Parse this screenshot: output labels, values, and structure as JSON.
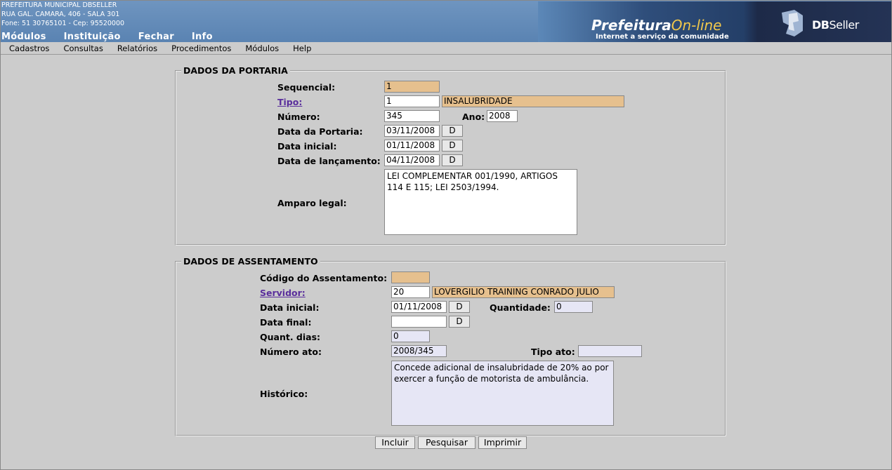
{
  "org": {
    "name": "PREFEITURA MUNICIPAL DBSELLER",
    "address": "RUA GAL. CAMARA, 406 - SALA 301",
    "contact": "Fone: 51 30765101  -  Cep: 95520000"
  },
  "top_menu": [
    "Módulos",
    "Instituição",
    "Fechar",
    "Info"
  ],
  "banner": {
    "prefeitura": "Prefeitura",
    "online": "On-line",
    "tagline": "Internet a serviço da comunidade",
    "db": "DB",
    "seller": "Seller"
  },
  "sub_menu": [
    "Cadastros",
    "Consultas",
    "Relatórios",
    "Procedimentos",
    "Módulos",
    "Help"
  ],
  "portaria": {
    "legend": "DADOS DA PORTARIA",
    "sequencial_label": "Sequencial:",
    "sequencial": "1",
    "tipo_label": "Tipo:",
    "tipo_code": "1",
    "tipo_desc": "INSALUBRIDADE",
    "numero_label": "Número:",
    "numero": "345",
    "ano_label": "Ano:",
    "ano": "2008",
    "data_portaria_label": "Data da Portaria:",
    "data_portaria": "03/11/2008",
    "data_inicial_label": "Data inicial:",
    "data_inicial": "01/11/2008",
    "data_lancamento_label": "Data de lançamento:",
    "data_lancamento": "04/11/2008",
    "date_button": "D",
    "amparo_label": "Amparo legal:",
    "amparo": "LEI COMPLEMENTAR 001/1990, ARTIGOS 114 E 115; LEI 2503/1994."
  },
  "assentamento": {
    "legend": "DADOS DE ASSENTAMENTO",
    "codigo_label": "Código do Assentamento:",
    "codigo": "",
    "servidor_label": "Servidor:",
    "servidor_code": "20",
    "servidor_name": "LOVERGILIO TRAINING CONRADO JULIO",
    "data_inicial_label": "Data inicial:",
    "data_inicial": "01/11/2008",
    "quantidade_label": "Quantidade:",
    "quantidade": "0",
    "data_final_label": "Data final:",
    "data_final": "",
    "quant_dias_label": "Quant. dias:",
    "quant_dias": "0",
    "numero_ato_label": "Número ato:",
    "numero_ato": "2008/345",
    "tipo_ato_label": "Tipo ato:",
    "tipo_ato": "",
    "historico_label": "Histórico:",
    "historico": "Concede adicional de insalubridade de 20% ao por exercer a função de motorista de ambulância.",
    "date_button": "D"
  },
  "actions": {
    "incluir": "Incluir",
    "pesquisar": "Pesquisar",
    "imprimir": "Imprimir"
  },
  "colors": {
    "header": "#5a83b2",
    "readonly_field": "#e6c08e",
    "pale_field": "#e6e6f5",
    "background": "#cccccc"
  }
}
